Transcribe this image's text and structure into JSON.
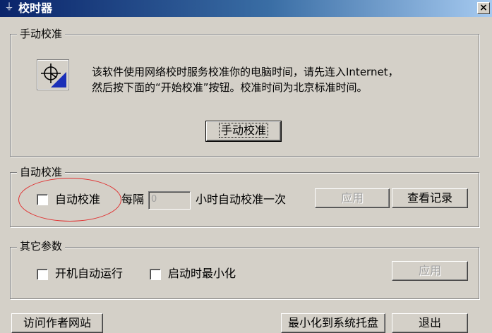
{
  "window": {
    "title": "校时器",
    "title_icon": "app-icon",
    "close_label": "×"
  },
  "manual": {
    "group_label": "手动校准",
    "icon": "clock-sync-icon",
    "description_line1": "该软件使用网络校时服务校准你的电脑时间，请先连入Internet，",
    "description_line2": "然后按下面的“开始校准”按钮。校准时间为北京标准时间。",
    "button_label": "手动校准"
  },
  "auto": {
    "group_label": "自动校准",
    "checkbox_label": "自动校准",
    "checkbox_checked": false,
    "interval_prefix": "每隔",
    "interval_value": "0",
    "interval_suffix": "小时自动校准一次",
    "apply_label": "应用",
    "apply_enabled": false,
    "log_label": "查看记录",
    "highlight_color": "#e03030"
  },
  "other": {
    "group_label": "其它参数",
    "startup_label": "开机自动运行",
    "startup_checked": false,
    "minimize_label": "启动时最小化",
    "minimize_checked": false,
    "apply_label": "应用",
    "apply_enabled": false
  },
  "footer": {
    "visit_label": "访问作者网站",
    "tray_label": "最小化到系统托盘",
    "exit_label": "退出"
  },
  "colors": {
    "face": "#d4d0c8",
    "title_start": "#0a246a",
    "title_end": "#a6caf0"
  }
}
